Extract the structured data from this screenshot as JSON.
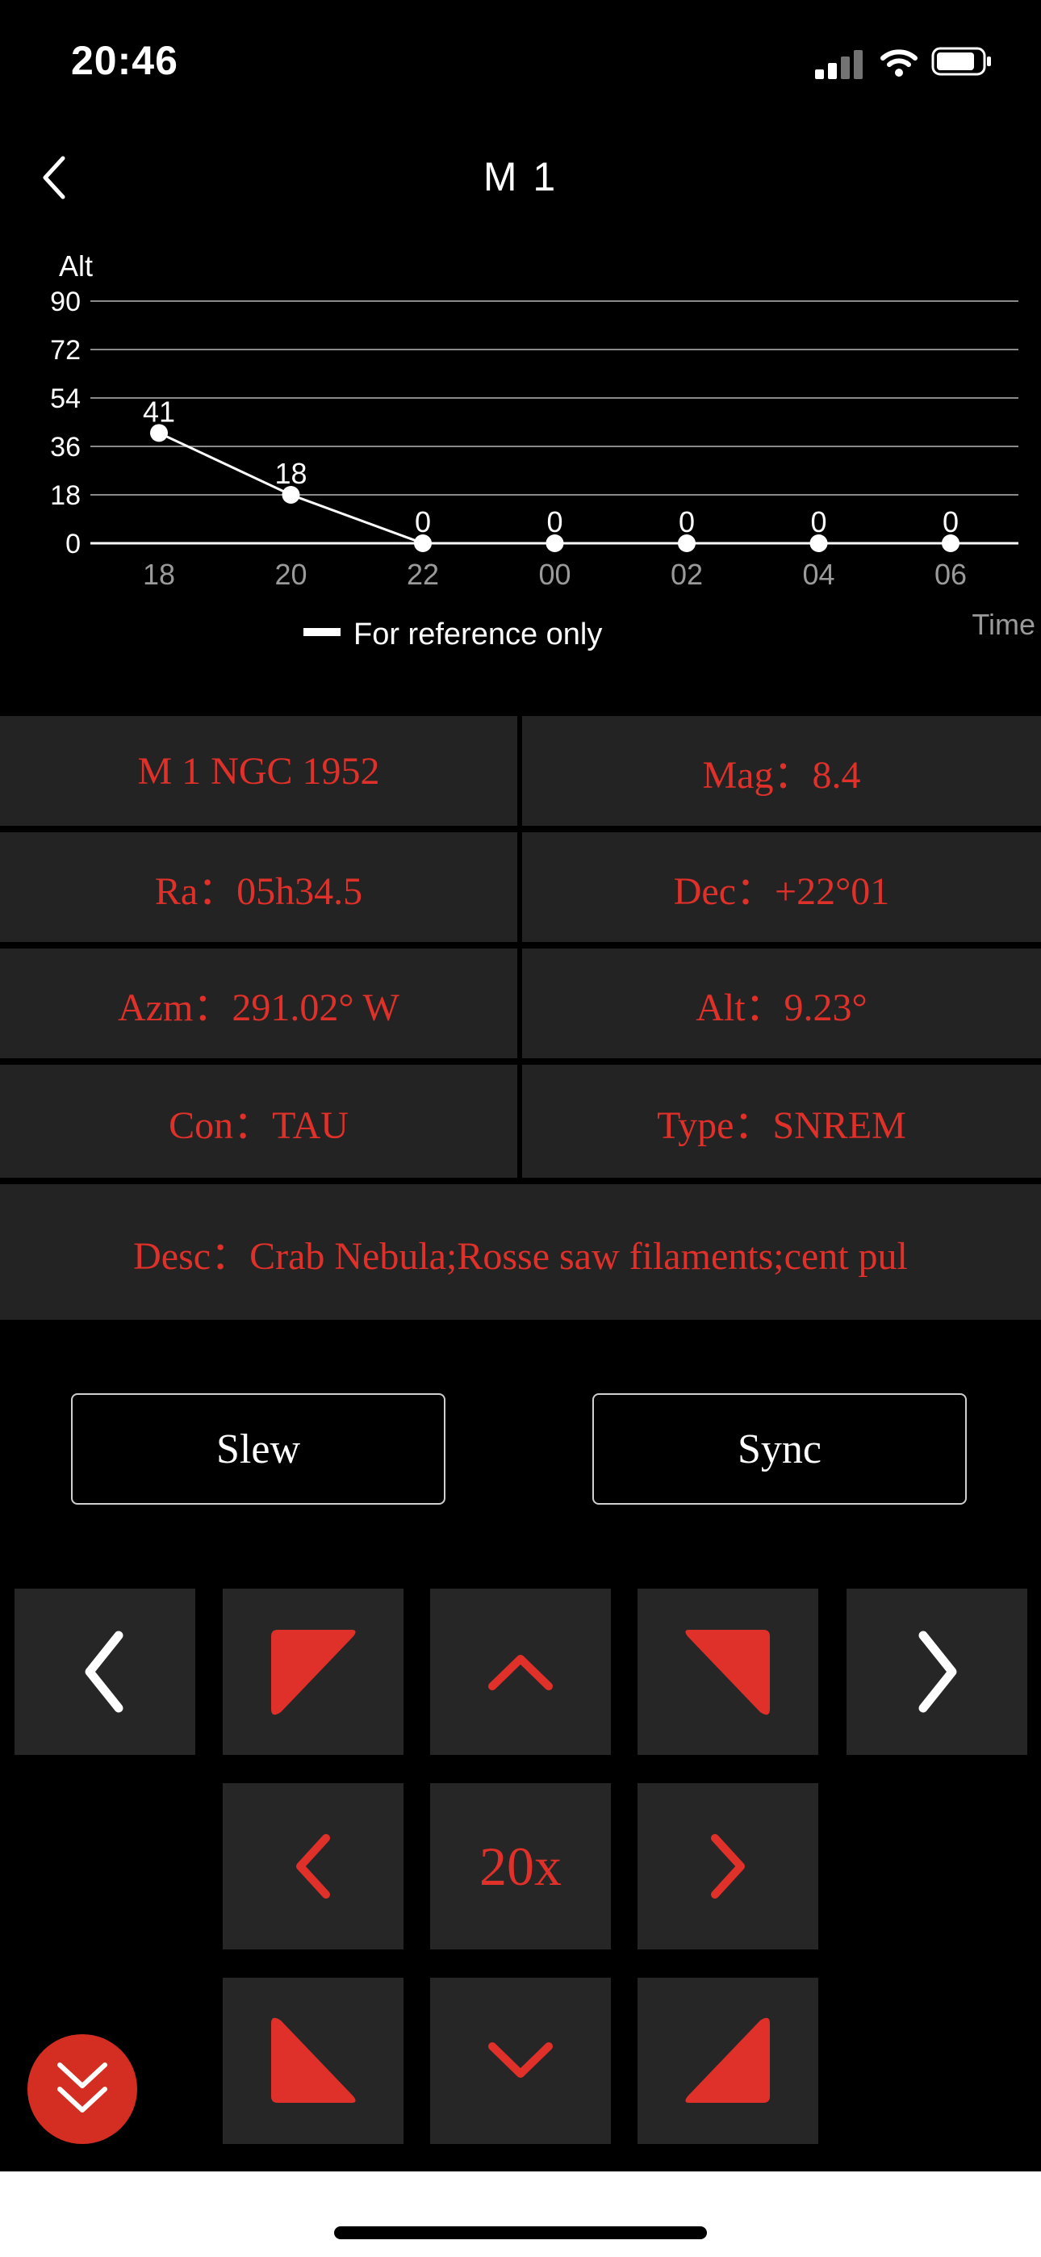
{
  "status_bar": {
    "time": "20:46"
  },
  "header": {
    "title": "M 1"
  },
  "chart_data": {
    "type": "line",
    "ylabel": "Alt",
    "xlabel": "Time",
    "y_ticks": [
      "90",
      "72",
      "54",
      "36",
      "18",
      "0"
    ],
    "categories": [
      "18",
      "20",
      "22",
      "00",
      "02",
      "04",
      "06"
    ],
    "values": [
      41,
      18,
      0,
      0,
      0,
      0,
      0
    ],
    "ylim": [
      0,
      90
    ],
    "grid": true,
    "legend": "For reference only",
    "legend_position": "bottom-center",
    "colors": {
      "line": "#ffffff",
      "grid": "#8a8a8a",
      "tick_label": "#9a9a9a"
    }
  },
  "info": {
    "name": "M 1 NGC 1952",
    "mag": "Mag：8.4",
    "ra": "Ra：05h34.5",
    "dec": "Dec：+22°01",
    "azm": "Azm：291.02° W",
    "alt": "Alt：9.23°",
    "con": "Con：TAU",
    "type": "Type：SNREM",
    "desc": "Desc：Crab Nebula;Rosse saw filaments;cent pul"
  },
  "actions": {
    "slew": "Slew",
    "sync": "Sync"
  },
  "keypad": {
    "speed": "20x",
    "icons": {
      "left_white": "chevron-left-icon",
      "right_white": "chevron-right-icon",
      "up": "chevron-up-icon",
      "down": "chevron-down-icon",
      "up_left": "arrow-up-left-icon",
      "up_right": "arrow-up-right-icon",
      "down_left": "arrow-down-left-icon",
      "down_right": "arrow-down-right-icon"
    }
  },
  "colors": {
    "accent": "#e0302a",
    "panel": "#232323",
    "background": "#000000"
  }
}
